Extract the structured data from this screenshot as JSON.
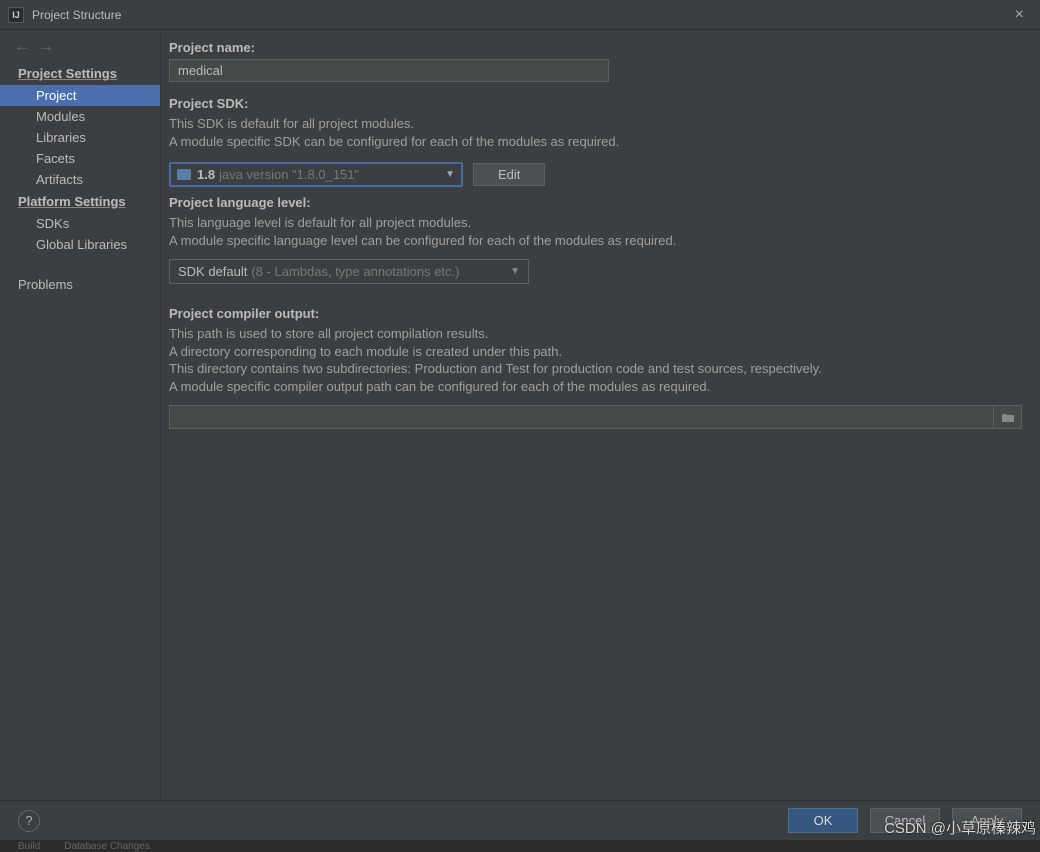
{
  "window": {
    "title": "Project Structure"
  },
  "sidebar": {
    "cat1": "Project Settings",
    "items1": [
      "Project",
      "Modules",
      "Libraries",
      "Facets",
      "Artifacts"
    ],
    "selectedIndex": 0,
    "cat2": "Platform Settings",
    "items2": [
      "SDKs",
      "Global Libraries"
    ],
    "problems": "Problems"
  },
  "project": {
    "name_label": "Project name:",
    "name_value": "medical",
    "sdk_label": "Project SDK:",
    "sdk_help1": "This SDK is default for all project modules.",
    "sdk_help2": "A module specific SDK can be configured for each of the modules as required.",
    "sdk_name": "1.8",
    "sdk_version": "java version \"1.8.0_151\"",
    "edit_btn": "Edit",
    "lang_label": "Project language level:",
    "lang_help1": "This language level is default for all project modules.",
    "lang_help2": "A module specific language level can be configured for each of the modules as required.",
    "lang_value": "SDK default",
    "lang_detail": "(8 - Lambdas, type annotations etc.)",
    "out_label": "Project compiler output:",
    "out_help1": "This path is used to store all project compilation results.",
    "out_help2": "A directory corresponding to each module is created under this path.",
    "out_help3": "This directory contains two subdirectories: Production and Test for production code and test sources, respectively.",
    "out_help4": "A module specific compiler output path can be configured for each of the modules as required.",
    "out_value": ""
  },
  "footer": {
    "ok": "OK",
    "cancel": "Cancel",
    "apply": "Apply"
  },
  "under": {
    "build": "Build",
    "db": "Database Changes"
  },
  "watermark": "CSDN @小草原榛辣鸡"
}
